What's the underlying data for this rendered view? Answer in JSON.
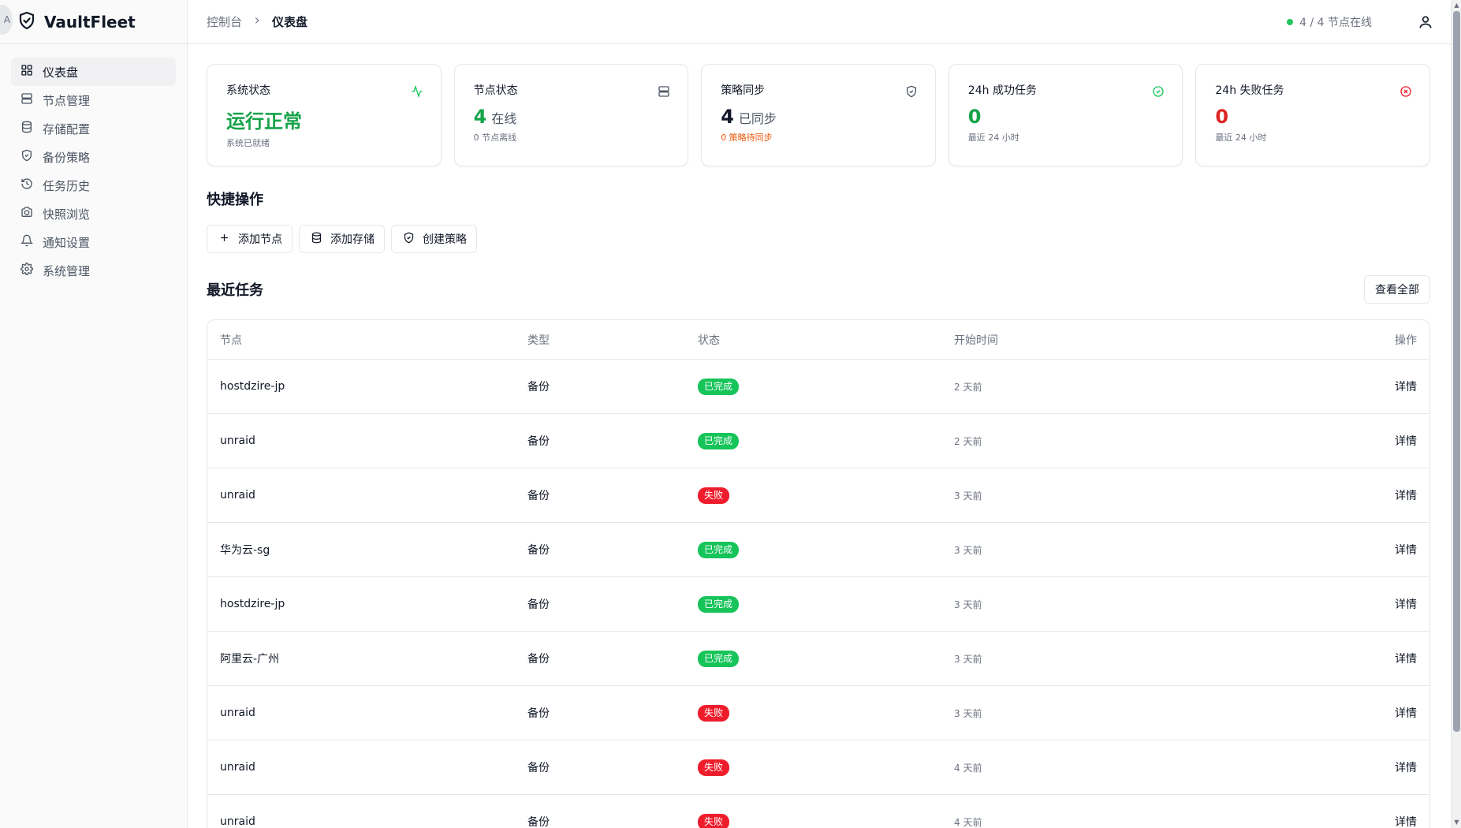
{
  "app": {
    "name": "VaultFleet",
    "avatar_letter": "A"
  },
  "sidebar": {
    "items": [
      {
        "label": "仪表盘",
        "icon": "dashboard-icon",
        "active": true
      },
      {
        "label": "节点管理",
        "icon": "server-icon"
      },
      {
        "label": "存储配置",
        "icon": "database-icon"
      },
      {
        "label": "备份策略",
        "icon": "shield-icon"
      },
      {
        "label": "任务历史",
        "icon": "history-icon"
      },
      {
        "label": "快照浏览",
        "icon": "camera-icon"
      },
      {
        "label": "通知设置",
        "icon": "bell-icon"
      },
      {
        "label": "系统管理",
        "icon": "gear-icon"
      }
    ]
  },
  "topbar": {
    "breadcrumb": {
      "parent": "控制台",
      "current": "仪表盘"
    },
    "online_status": "4 / 4 节点在线"
  },
  "cards": {
    "system": {
      "title": "系统状态",
      "value": "运行正常",
      "sub": "系统已就绪",
      "icon": "activity-icon"
    },
    "nodes": {
      "title": "节点状态",
      "value": "4",
      "unit": "在线",
      "sub": "0 节点离线",
      "icon": "server-icon"
    },
    "policy": {
      "title": "策略同步",
      "value": "4",
      "unit": "已同步",
      "sub": "0 策略待同步",
      "icon": "shield-icon"
    },
    "success": {
      "title": "24h 成功任务",
      "value": "0",
      "sub": "最近 24 小时",
      "icon": "check-circle-icon"
    },
    "failed": {
      "title": "24h 失败任务",
      "value": "0",
      "sub": "最近 24 小时",
      "icon": "x-circle-icon"
    }
  },
  "quick_actions": {
    "title": "快捷操作",
    "buttons": [
      {
        "label": "添加节点",
        "icon": "plus-icon"
      },
      {
        "label": "添加存储",
        "icon": "database-icon"
      },
      {
        "label": "创建策略",
        "icon": "shield-icon"
      }
    ]
  },
  "recent_tasks": {
    "title": "最近任务",
    "view_all": "查看全部",
    "columns": {
      "node": "节点",
      "type": "类型",
      "status": "状态",
      "start": "开始时间",
      "action": "操作"
    },
    "rows": [
      {
        "node": "hostdzire-jp",
        "type": "备份",
        "status": "已完成",
        "status_kind": "ok",
        "start": "2 天前",
        "action": "详情"
      },
      {
        "node": "unraid",
        "type": "备份",
        "status": "已完成",
        "status_kind": "ok",
        "start": "2 天前",
        "action": "详情"
      },
      {
        "node": "unraid",
        "type": "备份",
        "status": "失败",
        "status_kind": "fail",
        "start": "3 天前",
        "action": "详情"
      },
      {
        "node": "华为云-sg",
        "type": "备份",
        "status": "已完成",
        "status_kind": "ok",
        "start": "3 天前",
        "action": "详情"
      },
      {
        "node": "hostdzire-jp",
        "type": "备份",
        "status": "已完成",
        "status_kind": "ok",
        "start": "3 天前",
        "action": "详情"
      },
      {
        "node": "阿里云-广州",
        "type": "备份",
        "status": "已完成",
        "status_kind": "ok",
        "start": "3 天前",
        "action": "详情"
      },
      {
        "node": "unraid",
        "type": "备份",
        "status": "失败",
        "status_kind": "fail",
        "start": "3 天前",
        "action": "详情"
      },
      {
        "node": "unraid",
        "type": "备份",
        "status": "失败",
        "status_kind": "fail",
        "start": "4 天前",
        "action": "详情"
      },
      {
        "node": "unraid",
        "type": "备份",
        "status": "失败",
        "status_kind": "fail",
        "start": "4 天前",
        "action": "详情"
      }
    ]
  },
  "colors": {
    "success": "#16c45a",
    "danger": "#ef1d2c",
    "warning": "#ea580c",
    "online_dot": "#22c55e"
  }
}
